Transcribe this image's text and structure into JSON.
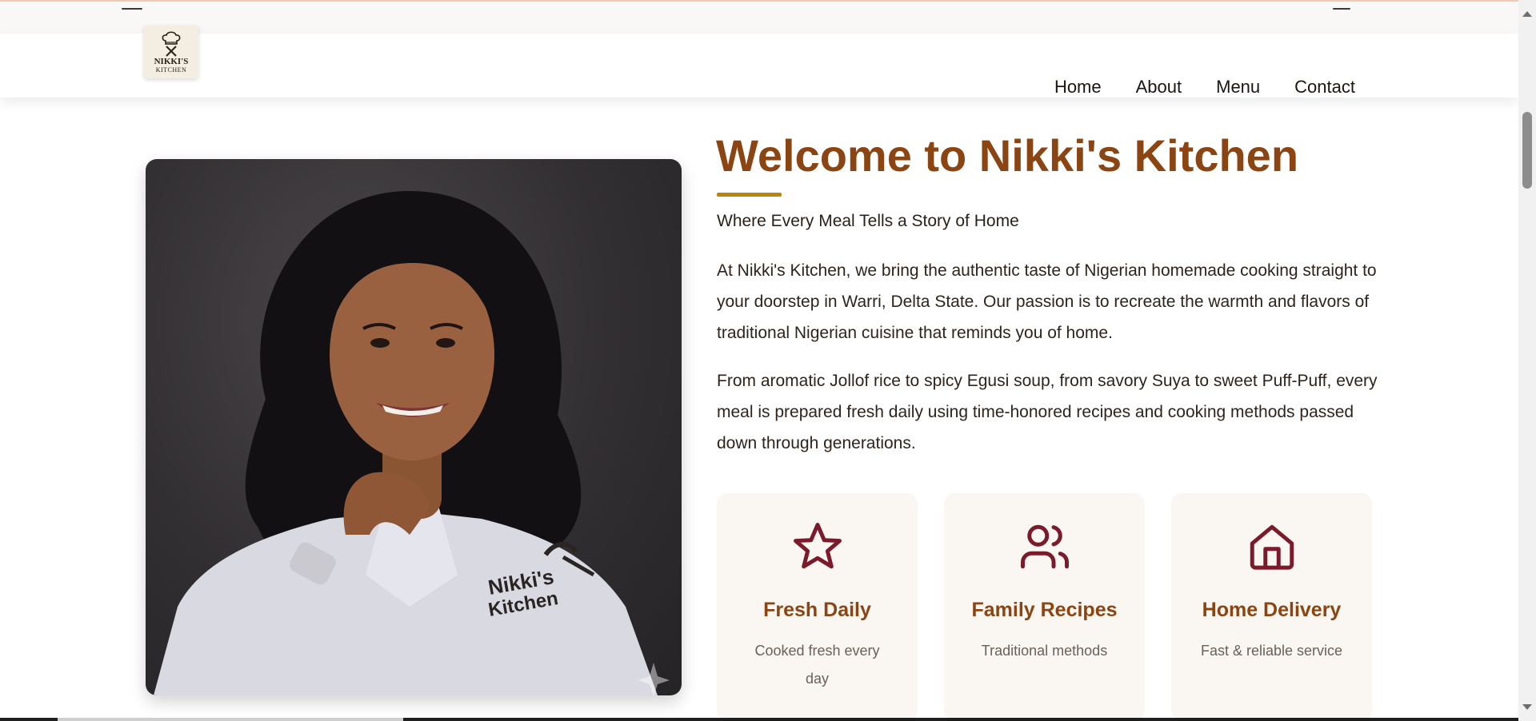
{
  "brand": {
    "logo_line1": "NIKKI'S",
    "logo_line2": "KITCHEN"
  },
  "nav": [
    {
      "label": "Home"
    },
    {
      "label": "About"
    },
    {
      "label": "Menu"
    },
    {
      "label": "Contact"
    }
  ],
  "hero": {
    "title": "Welcome to Nikki's Kitchen",
    "tagline": "Where Every Meal Tells a Story of Home",
    "paragraph1": "At Nikki's Kitchen, we bring the authentic taste of Nigerian homemade cooking straight to your doorstep in Warri, Delta State. Our passion is to recreate the warmth and flavors of traditional Nigerian cuisine that reminds you of home.",
    "paragraph2": "From aromatic Jollof rice to spicy Egusi soup, from savory Suya to sweet Puff-Puff, every meal is prepared fresh daily using time-honored recipes and cooking methods passed down through generations.",
    "photo_text": {
      "line1": "Nikki's",
      "line2": "Kitchen"
    }
  },
  "features": [
    {
      "icon": "star-icon",
      "title": "Fresh Daily",
      "desc": "Cooked fresh every day"
    },
    {
      "icon": "users-icon",
      "title": "Family Recipes",
      "desc": "Traditional methods"
    },
    {
      "icon": "home-icon",
      "title": "Home Delivery",
      "desc": "Fast & reliable service"
    }
  ],
  "colors": {
    "accent": "#8b4513",
    "underline": "#b8860b",
    "icon": "#7b1a2b",
    "card_bg": "#faf6f1"
  }
}
